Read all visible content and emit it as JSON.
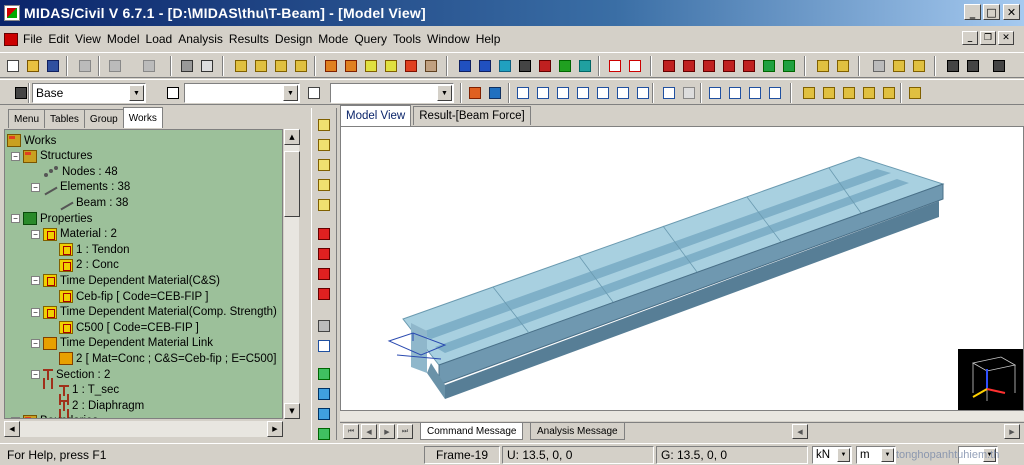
{
  "window": {
    "title": "MIDAS/Civil V 6.7.1 - [D:\\MIDAS\\thu\\T-Beam] - [Model View]"
  },
  "menu": [
    "File",
    "Edit",
    "View",
    "Model",
    "Load",
    "Analysis",
    "Results",
    "Design",
    "Mode",
    "Query",
    "Tools",
    "Window",
    "Help"
  ],
  "toolbar2": {
    "layer_combo": "Base",
    "combo2": "",
    "combo3": ""
  },
  "left_panel": {
    "tabs": [
      "Menu",
      "Tables",
      "Group",
      "Works"
    ],
    "active_tab": "Works"
  },
  "tree": [
    {
      "label": "Works",
      "icon": "folder-icon"
    },
    {
      "label": "Structures",
      "icon": "folder-icon"
    },
    {
      "label": "Nodes : 48",
      "icon": "nodes-icon"
    },
    {
      "label": "Elements : 38",
      "icon": "elements-icon"
    },
    {
      "label": "Beam : 38",
      "icon": "beam-icon"
    },
    {
      "label": "Properties",
      "icon": "properties-icon"
    },
    {
      "label": "Material : 2",
      "icon": "material-icon"
    },
    {
      "label": "1 : Tendon",
      "icon": "material-icon"
    },
    {
      "label": "2 : Conc",
      "icon": "material-icon"
    },
    {
      "label": "Time Dependent Material(C&S)",
      "icon": "material-icon"
    },
    {
      "label": "Ceb-fip [ Code=CEB-FIP ]",
      "icon": "material-icon"
    },
    {
      "label": "Time Dependent Material(Comp. Strength)",
      "icon": "material-icon"
    },
    {
      "label": "C500 [ Code=CEB-FIP ]",
      "icon": "material-icon"
    },
    {
      "label": "Time Dependent Material Link",
      "icon": "material-link-icon"
    },
    {
      "label": "2 [ Mat=Conc ; C&S=Ceb-fip ; E=C500]",
      "icon": "material-link-icon"
    },
    {
      "label": "Section : 2",
      "icon": "section-icon"
    },
    {
      "label": "1 : T_sec",
      "icon": "section-icon"
    },
    {
      "label": "2 : Diaphragm",
      "icon": "section-icon"
    },
    {
      "label": "Boundaries",
      "icon": "folder-icon"
    }
  ],
  "view_tabs": [
    "Model View",
    "Result-[Beam Force]"
  ],
  "message_tabs": [
    "Command Message",
    "Analysis Message"
  ],
  "status": {
    "help": "For Help, press F1",
    "frame": "Frame-19",
    "u": "U: 13.5, 0, 0",
    "g": "G: 13.5, 0, 0",
    "force_unit": "kN",
    "length_unit": "m",
    "extra_unit": "",
    "watermark": "tonghopanhtuhiem.th"
  },
  "colors": {
    "tree_bg": "#9cc09a",
    "beam": "#a8d0e0",
    "beam_dark": "#5f8fa8",
    "title_start": "#0a246a"
  }
}
